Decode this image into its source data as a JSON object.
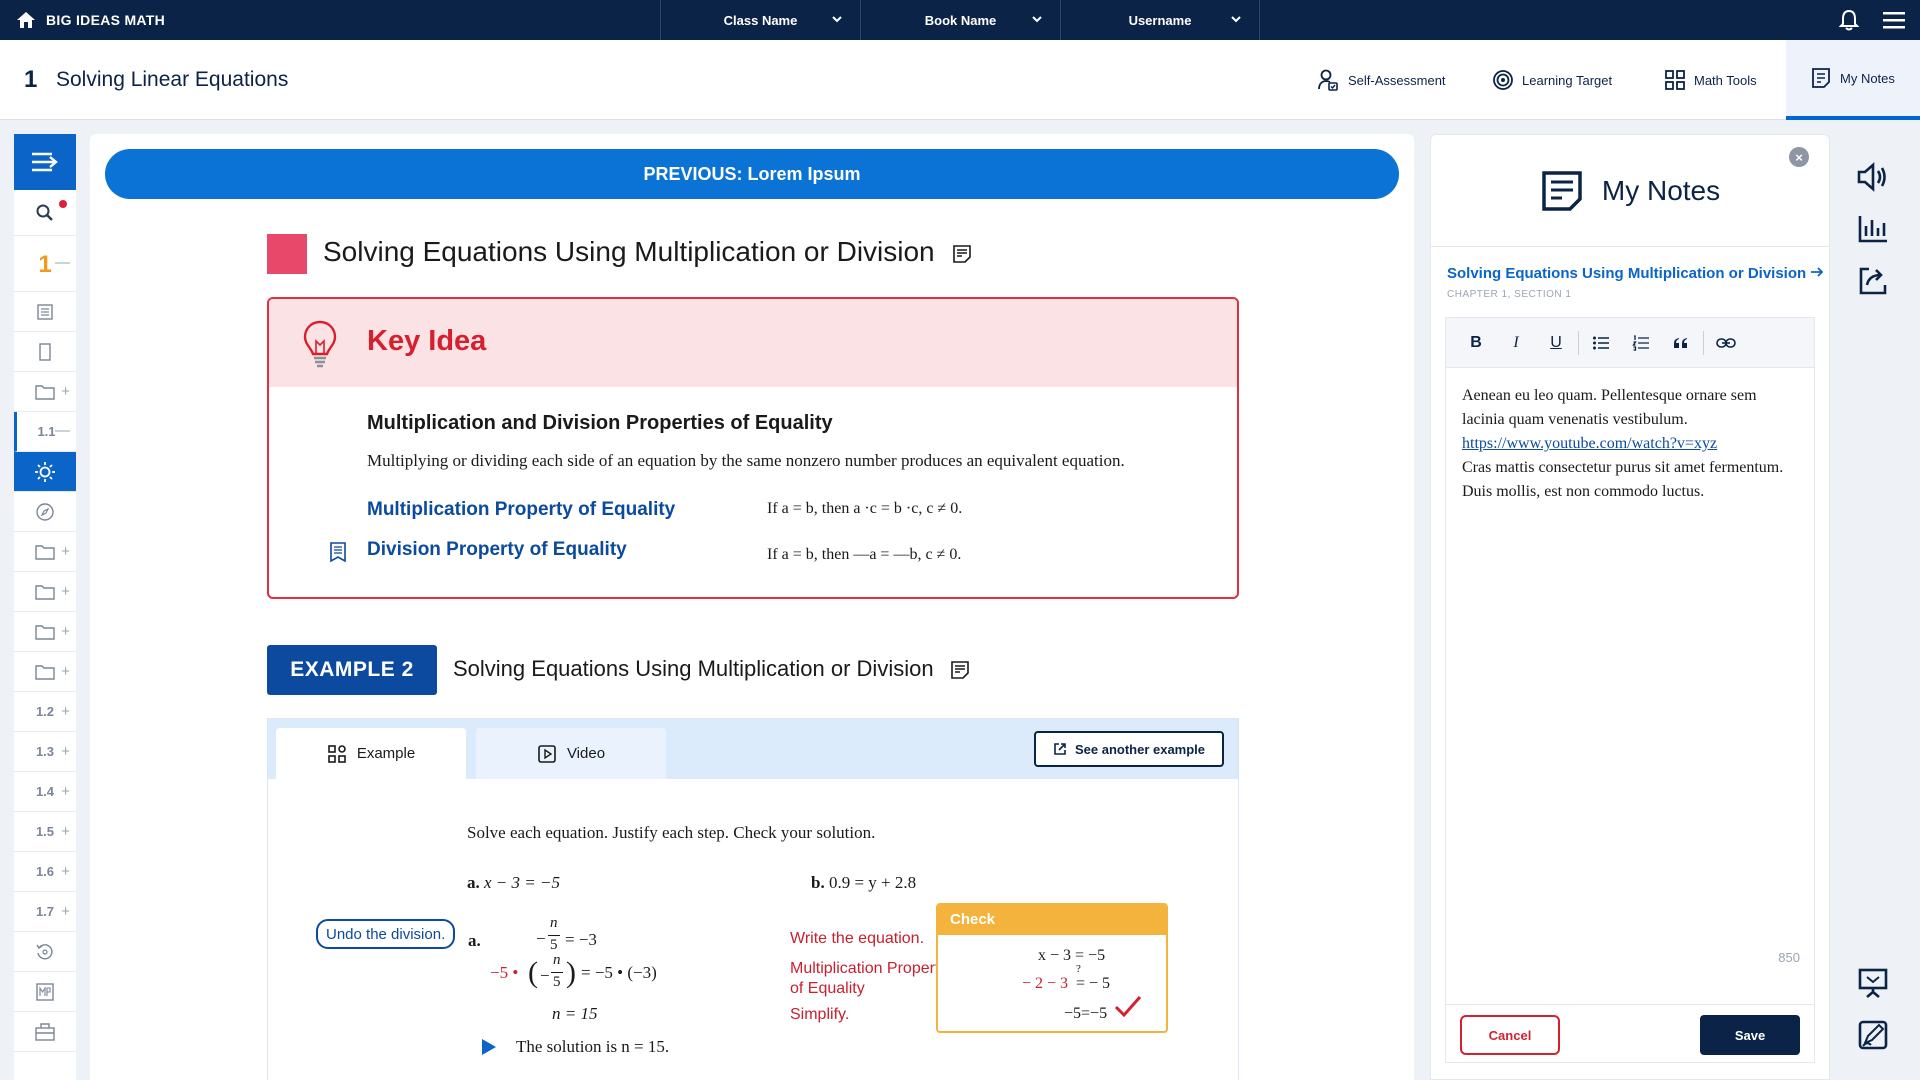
{
  "topbar": {
    "brand": "BIG IDEAS MATH",
    "class_name": "Class Name",
    "book_name": "Book Name",
    "username": "Username"
  },
  "header": {
    "chapter_number": "1",
    "chapter_title": "Solving Linear Equations",
    "tabs": [
      {
        "label": "Self-Assessment",
        "icon": "self-assessment-icon"
      },
      {
        "label": "Learning Target",
        "icon": "target-icon"
      },
      {
        "label": "Math Tools",
        "icon": "grid-icon"
      },
      {
        "label": "My Notes",
        "icon": "notes-icon",
        "active": true
      }
    ]
  },
  "rail": {
    "items": [
      {
        "label": "1",
        "type": "chapter"
      },
      {
        "label": "1.1",
        "type": "section"
      },
      {
        "label": "1.2"
      },
      {
        "label": "1.3"
      },
      {
        "label": "1.4"
      },
      {
        "label": "1.5"
      },
      {
        "label": "1.6"
      },
      {
        "label": "1.7"
      }
    ]
  },
  "content": {
    "previous_label": "PREVIOUS: Lorem Ipsum",
    "section_title": "Solving Equations Using Multiplication or Division",
    "key_idea": {
      "title": "Key Idea",
      "subtitle": "Multiplication and Division Properties of Equality",
      "description": "Multiplying or dividing each side of an equation by the same nonzero number produces an equivalent equation.",
      "properties": [
        {
          "name": "Multiplication Property of Equality",
          "formula": "If a = b, then a ·c = b ·c, c ≠ 0."
        },
        {
          "name": "Division Property of Equality",
          "formula": "If a = b, then —a = —b, c ≠ 0."
        }
      ]
    },
    "example": {
      "badge": "EXAMPLE 2",
      "title": "Solving Equations Using Multiplication or Division",
      "tab_example": "Example",
      "tab_video": "Video",
      "see_another": "See another example",
      "instructions": "Solve each equation. Justify each step. Check your solution.",
      "problem_a_label": "a.",
      "problem_a": "x − 3 = −5",
      "problem_b_label": "b.",
      "problem_b": "0.9 = y + 2.8",
      "solution_label": "a.",
      "undo_button": "Undo the division.",
      "step1_eq_right": "= −3",
      "step2_eq_left": "−5 •",
      "step2_eq_right": "= −5 • (−3)",
      "step3_eq": "n = 15",
      "frac_num": "n",
      "frac_den": "5",
      "step_notes": [
        "Write the equation.",
        "Multiplication Property",
        "of Equality",
        "Simplify."
      ],
      "solution_text": "The solution is n = 15.",
      "check": {
        "title": "Check",
        "line1": "x − 3 = −5",
        "line2_left": "− 2 − 3",
        "line2_q": "?",
        "line2_right": "= − 5",
        "line3": "−5=−5"
      }
    }
  },
  "notes": {
    "title": "My Notes",
    "link": "Solving Equations Using Multiplication or Division",
    "chapter_label": "CHAPTER 1, SECTION 1",
    "toolbar": [
      "B",
      "I",
      "U"
    ],
    "text_1": "Aenean eu leo quam. Pellentesque ornare sem lacinia quam venenatis vestibulum.",
    "link_url": "https://www.youtube.com/watch?v=xyz",
    "text_2": "Cras mattis consectetur purus sit amet fermentum. Duis mollis, est non commodo luctus.",
    "char_count": "850",
    "cancel": "Cancel",
    "save": "Save"
  },
  "colors": {
    "nav": "#0b2347",
    "accent": "#0b72d6",
    "key_idea_red": "#d7202e",
    "check_yellow": "#f3b33d"
  }
}
